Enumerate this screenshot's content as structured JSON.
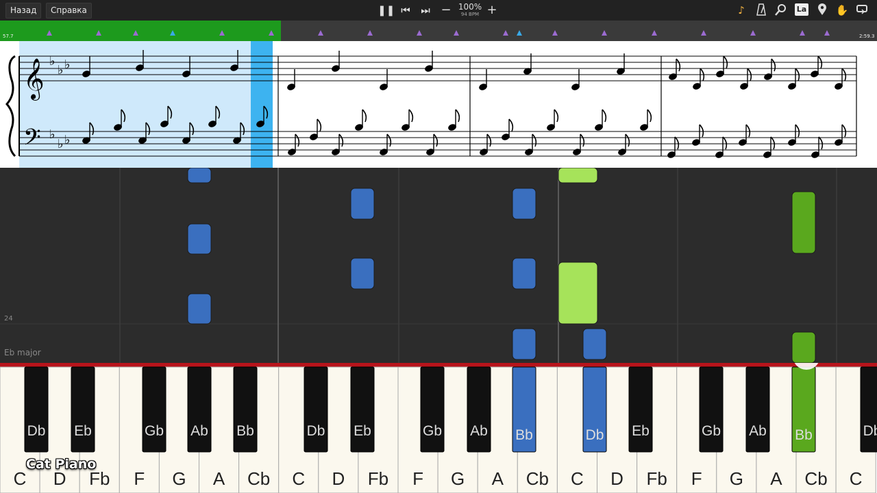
{
  "toolbar": {
    "back_label": "Назад",
    "help_label": "Справка",
    "tempo_percent": "100%",
    "tempo_bpm": "94 BPM",
    "la_label": "La"
  },
  "timeline": {
    "start_label": "57.7",
    "end_label": "2:59.3",
    "progress": 0.32
  },
  "score": {
    "key_signature": "Eb major flats"
  },
  "roll": {
    "marker_label": "24",
    "key_label": "Eb major"
  },
  "keyboard": {
    "white_keys": [
      "C",
      "D",
      "Fb",
      "F",
      "G",
      "A",
      "Cb",
      "C",
      "D",
      "Fb",
      "F",
      "G",
      "A",
      "Cb",
      "C",
      "D",
      "Fb",
      "F",
      "G",
      "A",
      "Cb",
      "C"
    ],
    "black_keys": [
      "Db",
      "Eb",
      "Gb",
      "Ab",
      "Bb",
      "Db",
      "Eb",
      "Gb",
      "Ab",
      "Bb",
      "Db",
      "Eb",
      "Gb",
      "Ab",
      "Bb",
      "Db"
    ],
    "pressed": [
      "Bb",
      "Db",
      "Bb"
    ],
    "colors": {
      "left_hand": "#3a6fbf",
      "right_hand": "#5aa81e",
      "right_hand_light": "#a6e35a"
    }
  },
  "watermark": "Cat Piano"
}
